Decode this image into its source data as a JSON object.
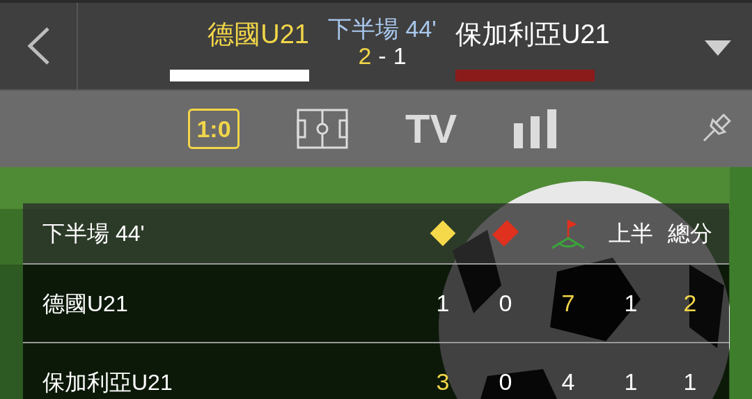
{
  "match": {
    "home": {
      "name": "德國U21",
      "color": "#ffffff"
    },
    "period": "下半場 44'",
    "score_home": "2",
    "score_separator": "-",
    "score_away": "1",
    "away": {
      "name": "保加利亞U21",
      "color": "#8b1a1a"
    }
  },
  "tabs": [
    {
      "kind": "text",
      "label": "1:0",
      "selected": true
    },
    {
      "kind": "pitch",
      "selected": false
    },
    {
      "kind": "text",
      "label": "TV",
      "selected": false
    },
    {
      "kind": "bars",
      "selected": false
    }
  ],
  "table": {
    "period": "下半場 44'",
    "columns": [
      {
        "kind": "yellow-card"
      },
      {
        "kind": "red-card"
      },
      {
        "kind": "corner"
      },
      {
        "kind": "text",
        "label": "上半"
      },
      {
        "kind": "text",
        "label": "總分"
      }
    ],
    "rows": [
      {
        "team": "德國U21",
        "cells": [
          {
            "value": "1",
            "highlight": false
          },
          {
            "value": "0",
            "highlight": false
          },
          {
            "value": "7",
            "highlight": true
          },
          {
            "value": "1",
            "highlight": false
          },
          {
            "value": "2",
            "highlight": true
          }
        ]
      },
      {
        "team": "保加利亞U21",
        "cells": [
          {
            "value": "3",
            "highlight": true
          },
          {
            "value": "0",
            "highlight": false
          },
          {
            "value": "4",
            "highlight": false
          },
          {
            "value": "1",
            "highlight": false
          },
          {
            "value": "1",
            "highlight": false
          }
        ]
      }
    ]
  }
}
